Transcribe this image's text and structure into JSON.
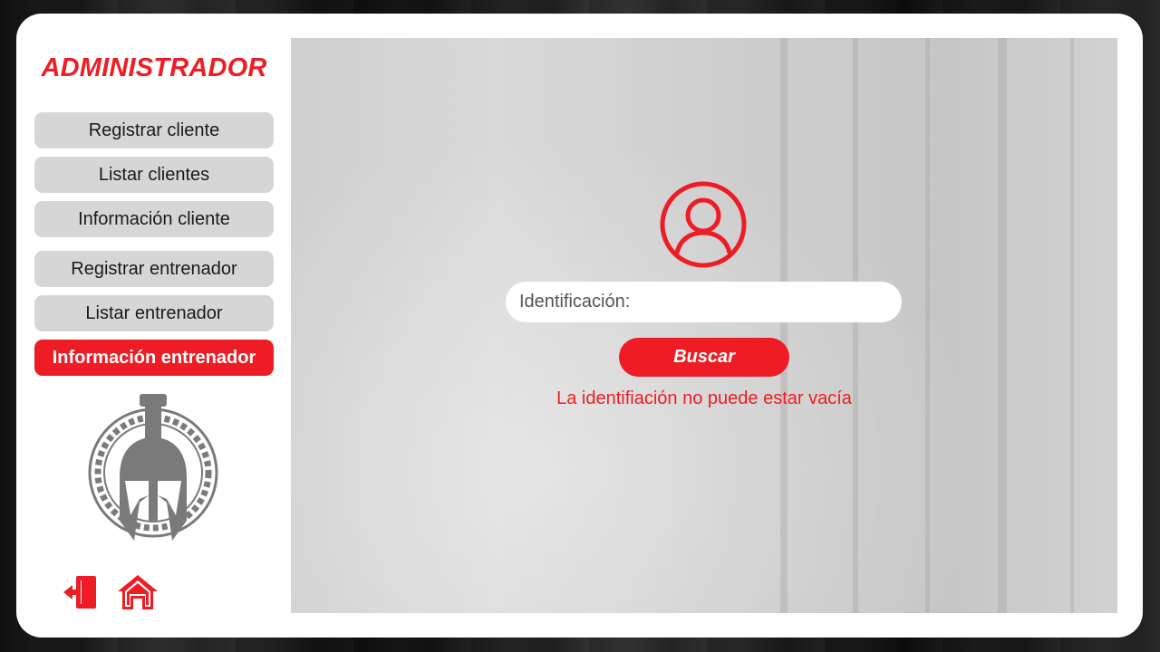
{
  "sidebar": {
    "title": "ADMINISTRADOR",
    "menu": [
      {
        "label": "Registrar cliente",
        "active": false
      },
      {
        "label": "Listar clientes",
        "active": false
      },
      {
        "label": "Información cliente",
        "active": false
      },
      {
        "label": "Registrar entrenador",
        "active": false
      },
      {
        "label": "Listar entrenador",
        "active": false
      },
      {
        "label": "Información entrenador",
        "active": true
      }
    ],
    "logo_icon": "spartan-helmet-logo",
    "bottom_icons": [
      "logout-door-icon",
      "home-icon"
    ]
  },
  "main": {
    "avatar_icon": "user-circle-icon",
    "id_field": {
      "placeholder": "Identificación:",
      "value": ""
    },
    "search_label": "Buscar",
    "error": "La identifiación no puede estar vacía"
  },
  "colors": {
    "accent": "#ee1c25",
    "button_gray": "#d6d6d6",
    "card": "#ffffff"
  }
}
